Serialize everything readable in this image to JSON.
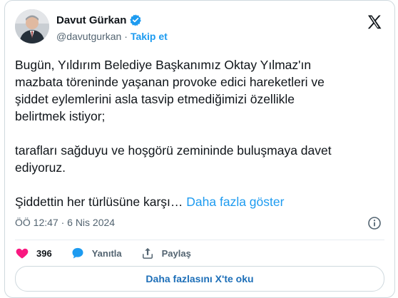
{
  "user": {
    "name": "Davut Gürkan",
    "handle": "@davutgurkan",
    "separator": "·",
    "follow_label": "Takip et"
  },
  "icons": {
    "verified": "verified-badge-icon",
    "x_logo": "x-logo-icon",
    "info": "info-icon",
    "like": "heart-icon",
    "reply": "reply-bubble-icon",
    "share": "share-icon"
  },
  "tweet": {
    "line1": "Bugün, Yıldırım Belediye Başkanımız Oktay Yılmaz'ın",
    "line2": "mazbata töreninde yaşanan provoke edici hareketleri ve",
    "line3": "şiddet eylemlerini asla tasvip etmediğimizi özellikle",
    "line4": "belirtmek istiyor;",
    "line5": "tarafları sağduyu ve hoşgörü zemininde buluşmaya davet",
    "line6": "ediyoruz.",
    "line7": "Şiddettin her türlüsüne karşı…",
    "show_more": "Daha fazla göster",
    "timestamp": "ÖÖ 12:47 · 6 Nis 2024"
  },
  "actions": {
    "like_count": "396",
    "reply_label": "Yanıtla",
    "share_label": "Paylaş"
  },
  "footer": {
    "read_more_label": "Daha fazlasını X'te oku"
  },
  "colors": {
    "accent": "#1d9bf0",
    "like": "#f91880",
    "text": "#0f1419",
    "muted": "#536471",
    "border": "#cfd9de"
  }
}
